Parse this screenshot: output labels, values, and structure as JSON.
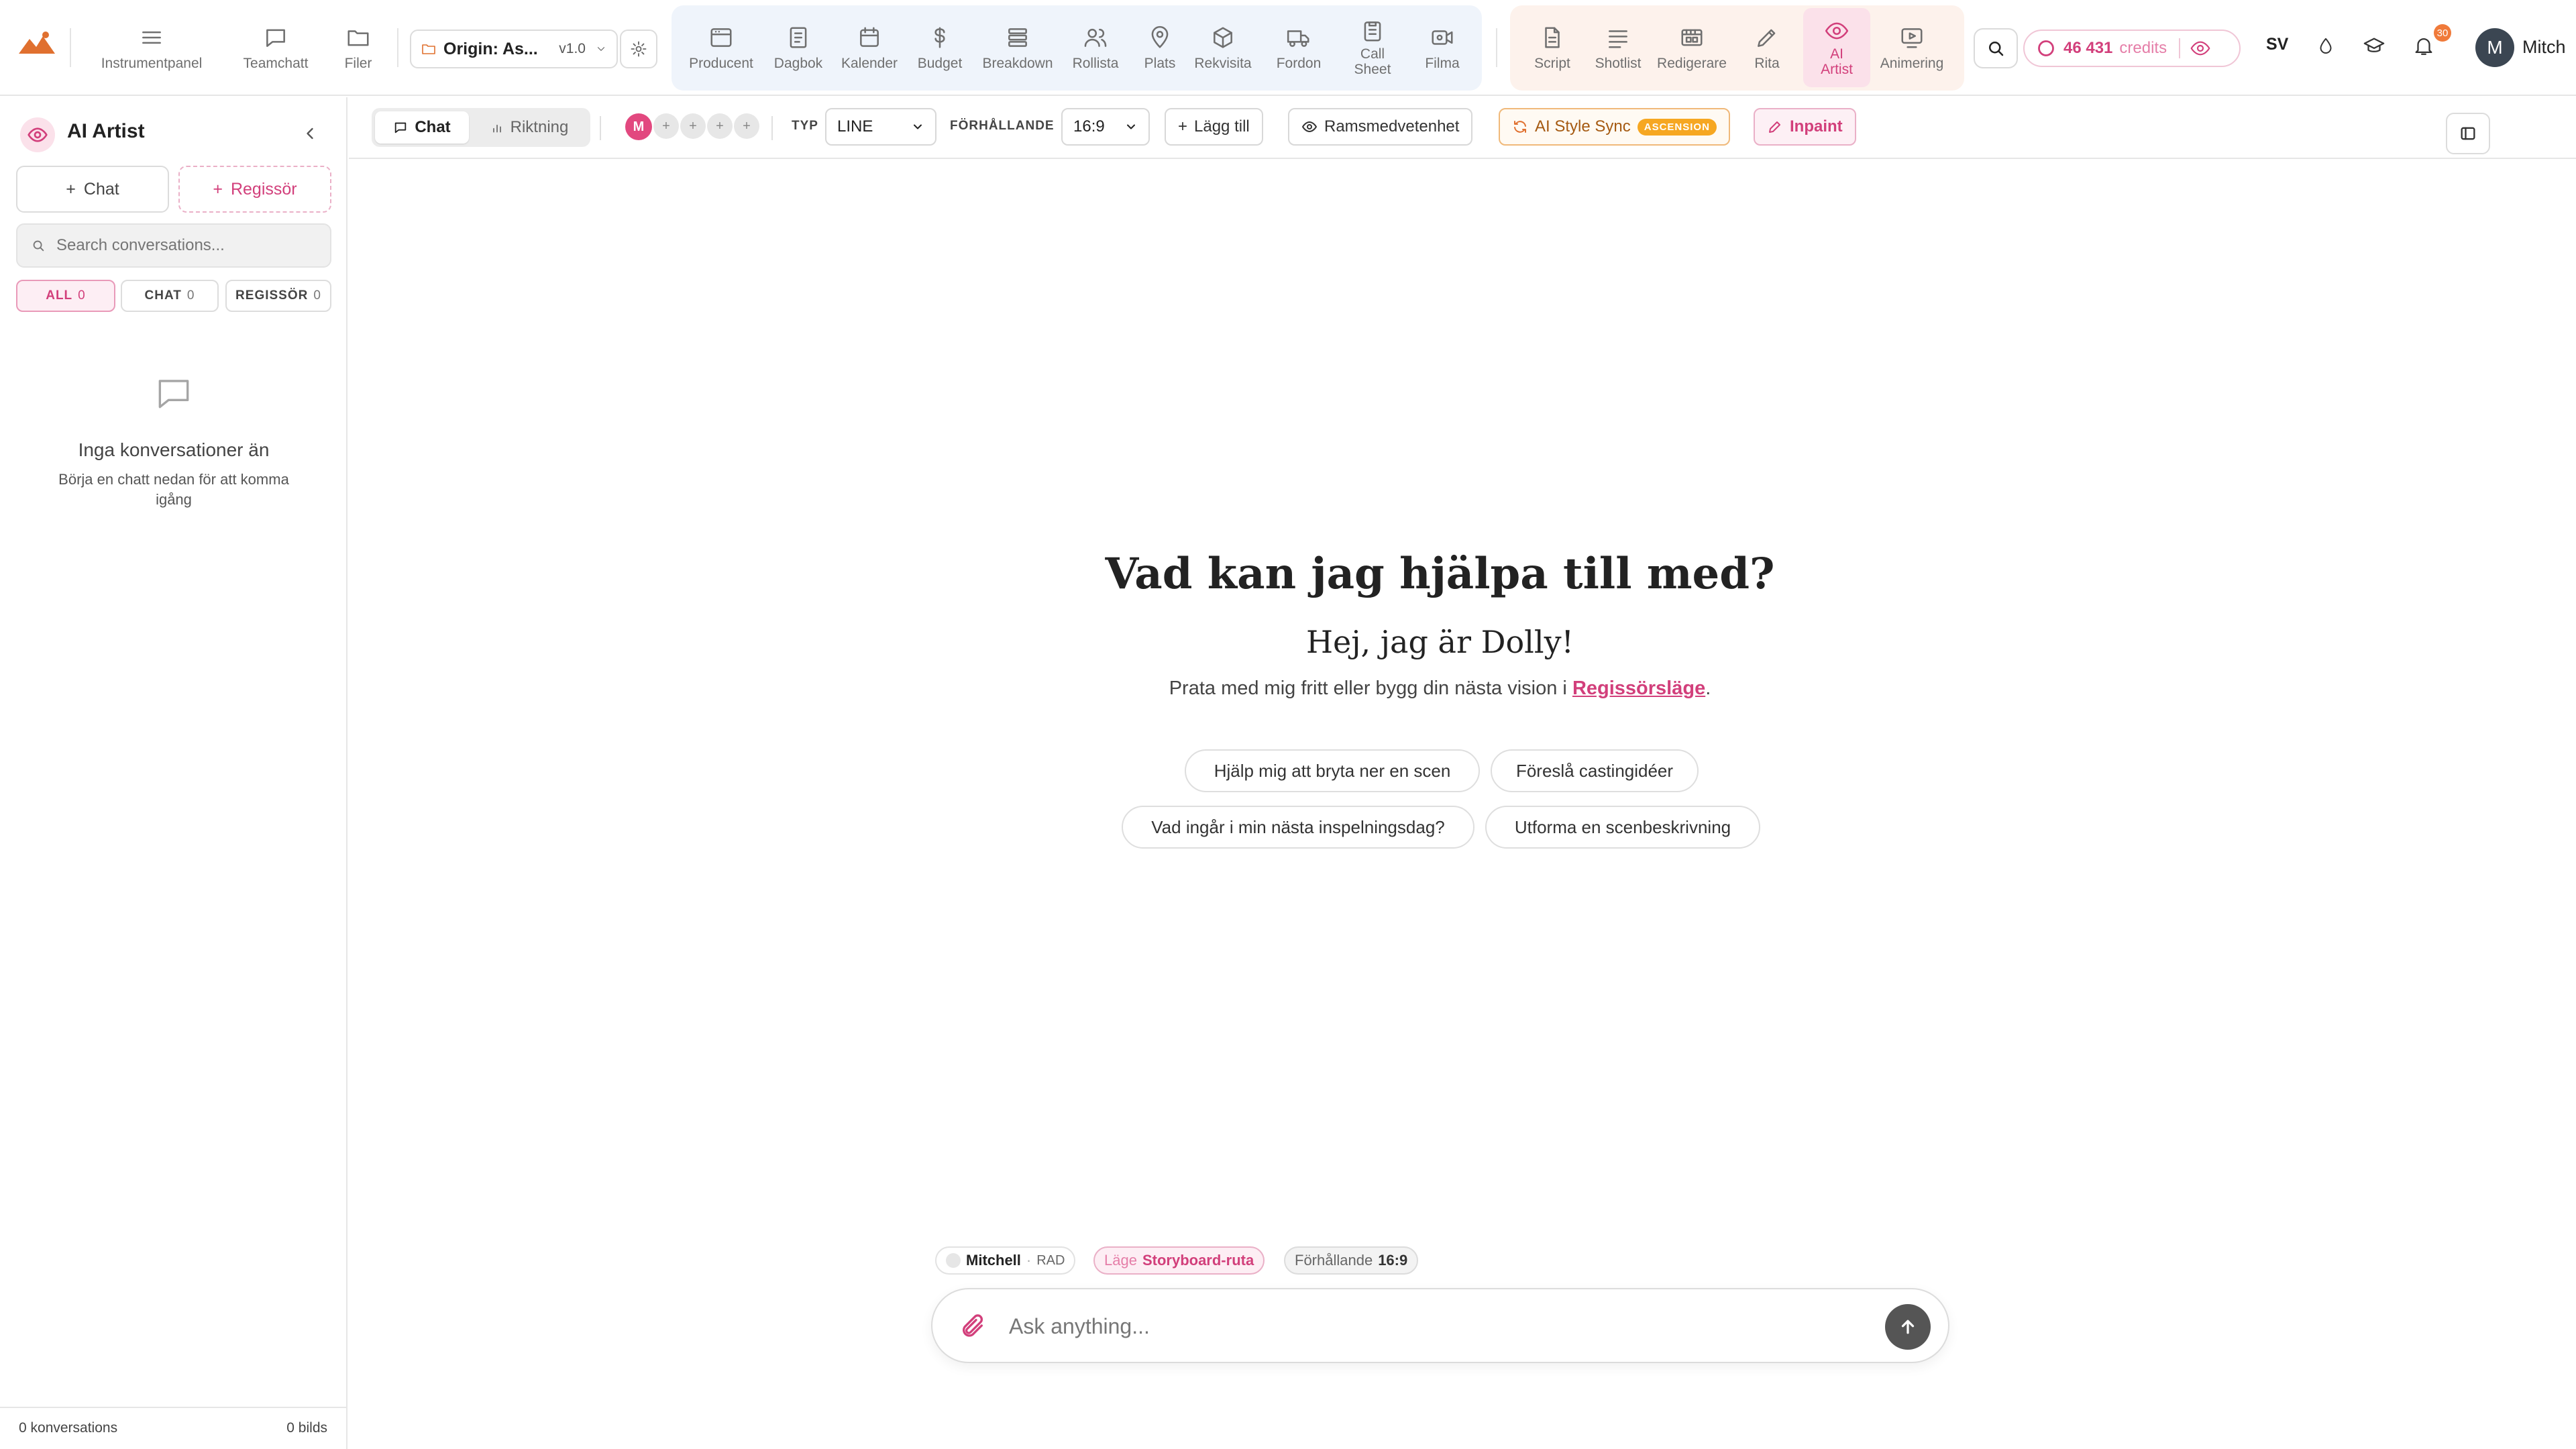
{
  "brand": {
    "logo_icon": "mountain-logo-icon",
    "accent": "#d23f7b"
  },
  "topnav": {
    "left_items": [
      {
        "label": "Instrumentpanel",
        "icon": "menu-icon"
      },
      {
        "label": "Teamchatt",
        "icon": "chat-icon"
      },
      {
        "label": "Filer",
        "icon": "folder-icon"
      }
    ],
    "project": {
      "name": "Origin: As...",
      "version": "v1.0"
    },
    "production_items": [
      {
        "label": "Producent",
        "icon": "browser-window-icon"
      },
      {
        "label": "Dagbok",
        "icon": "notebook-icon"
      },
      {
        "label": "Kalender",
        "icon": "calendar-icon"
      },
      {
        "label": "Budget",
        "icon": "dollar-icon"
      },
      {
        "label": "Breakdown",
        "icon": "stack-icon"
      },
      {
        "label": "Rollista",
        "icon": "people-icon"
      },
      {
        "label": "Plats",
        "icon": "location-pin-icon"
      },
      {
        "label": "Rekvisita",
        "icon": "box-icon"
      },
      {
        "label": "Fordon",
        "icon": "truck-icon"
      },
      {
        "label": "Call Sheet",
        "icon": "clipboard-icon"
      },
      {
        "label": "Filma",
        "icon": "video-camera-icon"
      }
    ],
    "creative_items": [
      {
        "label": "Script",
        "icon": "document-icon"
      },
      {
        "label": "Shotlist",
        "icon": "list-icon"
      },
      {
        "label": "Redigerare",
        "icon": "film-editor-icon"
      },
      {
        "label": "Rita",
        "icon": "pencil-icon"
      },
      {
        "label": "AI Artist",
        "icon": "eye-icon",
        "active": true
      },
      {
        "label": "Animering",
        "icon": "play-screen-icon"
      }
    ],
    "credits": {
      "amount": "46 431",
      "unit": "credits"
    },
    "language": "SV",
    "notification_count": "30",
    "user": {
      "initial": "M",
      "name": "Mitch"
    }
  },
  "sidebar": {
    "title": "AI Artist",
    "new_chat": "Chat",
    "new_director": "Regissör",
    "search_placeholder": "Search conversations...",
    "filters": [
      {
        "label": "ALL",
        "count": "0",
        "active": true
      },
      {
        "label": "CHAT",
        "count": "0"
      },
      {
        "label": "REGISSÖR",
        "count": "0"
      }
    ],
    "empty_title": "Inga konversationer än",
    "empty_subtitle": "Börja en chatt nedan för att komma igång",
    "footer_conversations": "0 konversations",
    "footer_images": "0 bilds"
  },
  "toolbar": {
    "mode_chat": "Chat",
    "mode_direction": "Riktning",
    "member_initial": "M",
    "type_label": "TYP",
    "type_value": "LINE",
    "ratio_label": "FÖRHÅLLANDE",
    "ratio_value": "16:9",
    "add_label": "Lägg till",
    "frame_awareness": "Ramsmedvetenhet",
    "style_sync": "AI Style Sync",
    "style_sync_badge": "ASCENSION",
    "inpaint": "Inpaint"
  },
  "hero": {
    "title": "Vad kan jag hjälpa till med?",
    "subtitle": "Hej, jag är Dolly!",
    "description_prefix": "Prata med mig fritt eller bygg din nästa vision i ",
    "description_link": "Regissörsläge",
    "description_suffix": "."
  },
  "suggestions": [
    "Hjälp mig att bryta ner en scen",
    "Föreslå castingidéer",
    "Vad ingår i min nästa inspelningsdag?",
    "Utforma en scenbeskrivning"
  ],
  "context_chips": {
    "user_name": "Mitchell",
    "user_role": "RAD",
    "mode_label": "Läge",
    "mode_value": "Storyboard-ruta",
    "ratio_label": "Förhållande",
    "ratio_value": "16:9"
  },
  "composer": {
    "placeholder": "Ask anything..."
  }
}
